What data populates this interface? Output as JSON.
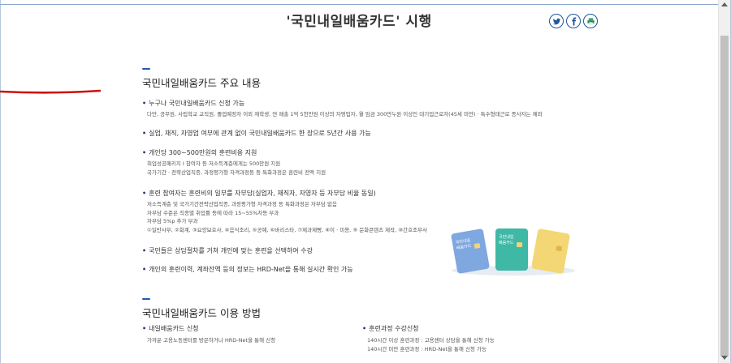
{
  "page": {
    "title": "'국민내일배움카드' 시행"
  },
  "share": {
    "icons": [
      "twitter-icon",
      "facebook-icon",
      "print-icon"
    ]
  },
  "section1": {
    "title": "국민내일배움카드 주요 내용",
    "items": [
      {
        "head": "누구나 국민내일배움카드 신청 가능",
        "subs": [
          "다만, 공무원, 사립학교 교직원, 졸업예정자 이외 재학생, 연 매출 1억 5천만원 이상의 자영업자, 월 임금 300만누원 이상인 대기업근로자(45세 미만) · 특수형태근로 종사자는 제외"
        ]
      },
      {
        "head": "실업, 재직, 자영업 여부에 관계 없이 국민내일배움카드 한 장으로 5년간 사용 가능",
        "subs": []
      },
      {
        "head": "개인당 300~500만원의 훈련비용 지원",
        "subs": [
          "취업성공패키지 I 참여자 등 저소득계층에게는 500만원 지원",
          "국가기간 · 전략산업직종, 과정평가형 자격과정등 등 특화과정은 훈련비 전액 지원"
        ]
      },
      {
        "head": "훈련 참여자는 훈련비의 일부를 자부담(실업자, 재직자, 자영자 등 자부담 비율 동일)",
        "subs": [
          "저소득계층 및 국가기간전략산업직종, 과정평가형 자격과정 등 특화과정은 자부담 없음",
          "자부담 수준은 직종별 취업률 등에 따라 15~55%차등 부과",
          "자부담 5%p 추가 부과",
          "①일반사무, ②회계, ③요양보호사, ④음식조리, ⑤공예, ⑥바리스타, ⑦제과제빵, ⑧이 · 미용, ⑨ 문화콘텐츠 제작, ⑩간호조무사"
        ]
      },
      {
        "head": "국민들은 상담절차를 거쳐 개인에 맞는 훈련을 선택하여 수강",
        "subs": []
      },
      {
        "head": "개인의 훈련이력, 계좌잔액 등의 정보는 HRD-Net을 통해 실시간 확인 가능",
        "subs": []
      }
    ]
  },
  "cards": {
    "label_line1": "국민내일",
    "label_line2": "배움카드",
    "colors": [
      "#7fa7e0",
      "#3fb8a5",
      "#f2d774"
    ]
  },
  "section2": {
    "title": "국민내일배움카드 이용 방법",
    "left": {
      "head": "내일배움카드 신청",
      "subs": [
        "가까운 고용노동센터를 방문하거나 HRD-Net을 통해 신청"
      ]
    },
    "right": {
      "head": "훈련과정 수강신청",
      "subs": [
        "140시간 이상 훈련과정 : 고용센터 상담을 통해 신청 가능",
        "140시간 미만 훈련과정 : HRD-Net을 통해 신청 가능"
      ]
    }
  },
  "colors": {
    "accent": "#1e5aa8",
    "underline": "#cc1111"
  }
}
